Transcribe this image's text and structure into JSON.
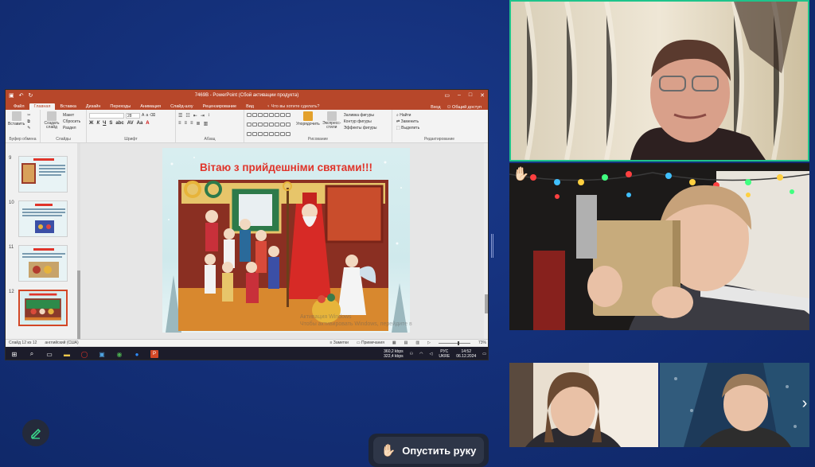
{
  "powerpoint": {
    "window_title": "7469В - PowerPoint (Сбой активации продукта)",
    "tabs": [
      "Файл",
      "Главная",
      "Вставка",
      "Дизайн",
      "Переходы",
      "Анимация",
      "Слайд-шоу",
      "Рецензирование",
      "Вид"
    ],
    "active_tab": "Главная",
    "tell_me": "Что вы хотите сделать?",
    "sign_in": "Вход",
    "share": "Общий доступ",
    "ribbon": {
      "clipboard": "Буфер обмена",
      "paste": "Вставить",
      "new_slide": "Создать слайд",
      "layout": "Макет",
      "reset": "Сбросить",
      "section": "Раздел",
      "slides": "Слайды",
      "font": "Шрифт",
      "font_size": "28",
      "paragraph": "Абзац",
      "drawing": "Рисование",
      "arrange": "Упорядочить",
      "quick_styles": "Экспресс-стили",
      "shape_fill": "Заливка фигуры",
      "shape_outline": "Контур фигуры",
      "shape_effects": "Эффекты фигуры",
      "find": "Найти",
      "replace": "Заменить",
      "select": "Выделить",
      "editing": "Редактирование"
    },
    "thumbnails": [
      {
        "num": "9"
      },
      {
        "num": "10"
      },
      {
        "num": "11"
      },
      {
        "num": "12",
        "selected": true
      }
    ],
    "slide": {
      "title": "Вітаю з прийдешніми святами!!!"
    },
    "watermark": {
      "line1": "Активация Windows",
      "line2": "Чтобы активировать Windows, перейдите в"
    },
    "status": {
      "slide_counter": "Слайд 12 из 12",
      "language": "английский (США)",
      "notes": "Заметки",
      "comments": "Примечания",
      "zoom": "73%"
    }
  },
  "taskbar": {
    "net_up": "360,2 kbps",
    "net_down": "322,4 kbps",
    "lang": "РУС",
    "lang2": "UKRE",
    "time": "14:52",
    "date": "06.12.2024"
  },
  "controls": {
    "raise_hand_label": "Опустить руку"
  },
  "colors": {
    "background": "#14307a",
    "ppt_accent": "#b7472a",
    "active_speaker_border": "#1ec48b",
    "slide_title": "#e0342a"
  },
  "icons": {
    "raise_hand": "raised-hand-icon",
    "pencil": "pencil-icon",
    "next": "chevron-right-icon"
  }
}
